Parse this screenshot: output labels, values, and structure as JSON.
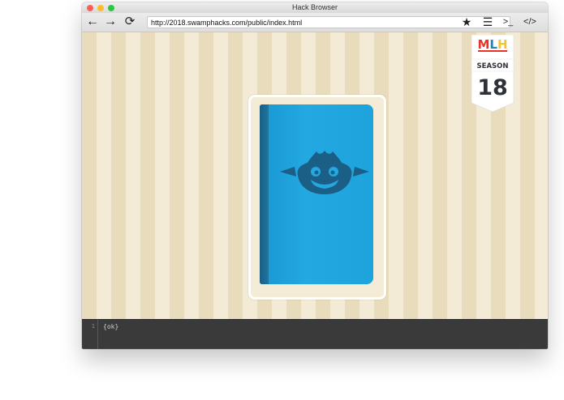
{
  "window": {
    "title": "Hack Browser"
  },
  "toolbar": {
    "back_icon": "←",
    "forward_icon": "→",
    "reload_icon": "⟳",
    "url": "http://2018.swamphacks.com/public/index.html",
    "bookmark_icon": "★",
    "list_icon": "☰",
    "terminal_icon": ">_",
    "code_icon": "</>"
  },
  "badge": {
    "brand": "MLH",
    "label": "SEASON",
    "number": "18",
    "colors": {
      "red": "#e73427",
      "blue": "#1a82c2",
      "yellow": "#f3c42d",
      "dark": "#2e3137"
    }
  },
  "book": {
    "colors": {
      "cover": "#23a8e2",
      "spine": "#1b5f83",
      "logo": "#1b5e86"
    }
  },
  "console": {
    "line_number": "1",
    "code": "{ok}"
  }
}
